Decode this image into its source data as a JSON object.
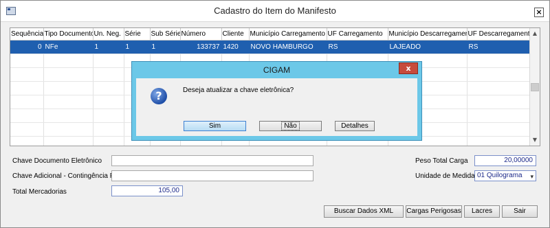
{
  "window": {
    "title": "Cadastro do Item do Manifesto"
  },
  "grid": {
    "columns": [
      "Sequência",
      "Tipo Documento",
      "Un. Neg.",
      "Série",
      "Sub Série",
      "Número",
      "Cliente",
      "Município Carregamento",
      "UF Carregamento",
      "Município Descarregamento",
      "UF Descarregamento"
    ],
    "rows": [
      {
        "sequencia": "0",
        "tipo": "NFe",
        "un_neg": "1",
        "serie": "1",
        "sub_serie": "1",
        "numero": "133737",
        "cliente": "1420",
        "mun_carreg": "NOVO HAMBURGO",
        "uf_carreg": "RS",
        "mun_descarreg": "LAJEADO",
        "uf_descarreg": "RS"
      }
    ]
  },
  "form": {
    "chave_doc_label": "Chave Documento Eletrônico",
    "chave_doc_value": "",
    "chave_adic_label": "Chave Adicional - Contingência FS",
    "chave_adic_value": "",
    "total_merc_label": "Total Mercadorias",
    "total_merc_value": "105,00",
    "peso_label": "Peso Total Carga",
    "peso_value": "20,00000",
    "unidade_label": "Unidade de Medida",
    "unidade_value": "01 Quilograma"
  },
  "buttons": {
    "buscar": "Buscar Dados XML",
    "cargas": "Cargas Perigosas",
    "lacres": "Lacres",
    "sair": "Sair"
  },
  "dialog": {
    "title": "CIGAM",
    "message": "Deseja atualizar a chave eletrônica?",
    "sim": "Sim",
    "nao": "Não",
    "detalhes": "Detalhes"
  }
}
